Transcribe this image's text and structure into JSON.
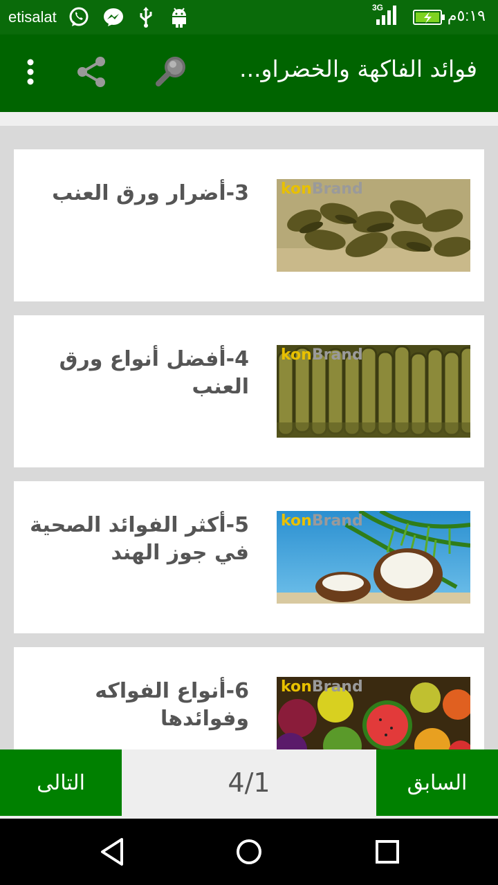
{
  "status_bar": {
    "carrier": "etisalat",
    "network": "3G",
    "time": "٥:١٩م",
    "icons": [
      "whatsapp-icon",
      "messenger-icon",
      "usb-icon",
      "android-icon",
      "signal-icon",
      "battery-charging-icon"
    ]
  },
  "app_bar": {
    "title": "فوائد الفاكهة والخضراو...",
    "icons": [
      "overflow-menu-icon",
      "share-icon",
      "search-icon"
    ]
  },
  "articles": [
    {
      "title": "3-أضرار ورق العنب",
      "watermark": "konBrand",
      "image": "stuffed-grape-leaves"
    },
    {
      "title": "4-أفضل أنواع ورق العنب",
      "watermark": "konBrand",
      "image": "rolled-grape-leaves"
    },
    {
      "title": "5-أكثر الفوائد الصحية في جوز الهند",
      "watermark": "konBrand",
      "image": "coconut"
    },
    {
      "title": "6-أنواع الفواكه وفوائدها",
      "watermark": "konBrand",
      "image": "assorted-fruits"
    }
  ],
  "pager": {
    "next_label": "التالى",
    "page_indicator": "4/1",
    "previous_label": "السابق"
  },
  "colors": {
    "app_bar": "#006400",
    "status_bar": "#0a6b0a",
    "pager_button": "#008000",
    "watermark_kon": "#e8c000",
    "watermark_brand": "#9a9a9a"
  }
}
